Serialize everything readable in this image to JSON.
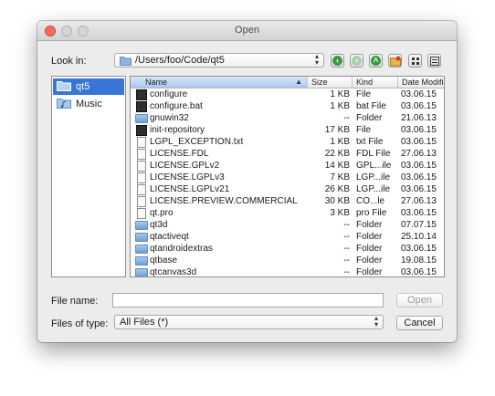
{
  "window": {
    "title": "Open"
  },
  "toolbar": {
    "look_in_label": "Look in:",
    "path": "/Users/foo/Code/qt5",
    "buttons": [
      "back-icon",
      "forward-icon",
      "parent-directory-icon",
      "new-folder-icon",
      "list-view-icon",
      "detail-view-icon"
    ]
  },
  "sidebar": {
    "items": [
      {
        "label": "qt5",
        "icon": "folder-icon",
        "selected": true
      },
      {
        "label": "Music",
        "icon": "music-folder-icon",
        "selected": false
      }
    ]
  },
  "file_list": {
    "columns": [
      "Name",
      "Size",
      "Kind",
      "Date Modified"
    ],
    "sort_column": "Name",
    "rows": [
      {
        "name": "configure",
        "size": "1 KB",
        "kind": "File",
        "date": "03.06.15",
        "icon": "executable-icon"
      },
      {
        "name": "configure.bat",
        "size": "1 KB",
        "kind": "bat File",
        "date": "03.06.15",
        "icon": "executable-icon"
      },
      {
        "name": "gnuwin32",
        "size": "--",
        "kind": "Folder",
        "date": "21.06.13",
        "icon": "folder-icon"
      },
      {
        "name": "init-repository",
        "size": "17 KB",
        "kind": "File",
        "date": "03.06.15",
        "icon": "executable-icon"
      },
      {
        "name": "LGPL_EXCEPTION.txt",
        "size": "1 KB",
        "kind": "txt File",
        "date": "03.06.15",
        "icon": "document-icon"
      },
      {
        "name": "LICENSE.FDL",
        "size": "22 KB",
        "kind": "FDL File",
        "date": "27.06.13",
        "icon": "document-icon"
      },
      {
        "name": "LICENSE.GPLv2",
        "size": "14 KB",
        "kind": "GPL...ile",
        "date": "03.06.15",
        "icon": "document-icon"
      },
      {
        "name": "LICENSE.LGPLv3",
        "size": "7 KB",
        "kind": "LGP...ile",
        "date": "03.06.15",
        "icon": "document-icon"
      },
      {
        "name": "LICENSE.LGPLv21",
        "size": "26 KB",
        "kind": "LGP...ile",
        "date": "03.06.15",
        "icon": "document-icon"
      },
      {
        "name": "LICENSE.PREVIEW.COMMERCIAL",
        "size": "30 KB",
        "kind": "CO...le",
        "date": "27.06.13",
        "icon": "document-icon"
      },
      {
        "name": "qt.pro",
        "size": "3 KB",
        "kind": "pro File",
        "date": "03.06.15",
        "icon": "document-icon"
      },
      {
        "name": "qt3d",
        "size": "--",
        "kind": "Folder",
        "date": "07.07.15",
        "icon": "folder-icon"
      },
      {
        "name": "qtactiveqt",
        "size": "--",
        "kind": "Folder",
        "date": "25.10.14",
        "icon": "folder-icon"
      },
      {
        "name": "qtandroidextras",
        "size": "--",
        "kind": "Folder",
        "date": "03.06.15",
        "icon": "folder-icon"
      },
      {
        "name": "qtbase",
        "size": "--",
        "kind": "Folder",
        "date": "19.08.15",
        "icon": "folder-icon"
      },
      {
        "name": "qtcanvas3d",
        "size": "--",
        "kind": "Folder",
        "date": "03.06.15",
        "icon": "folder-icon"
      }
    ]
  },
  "footer": {
    "file_name_label": "File name:",
    "file_name_value": "",
    "files_of_type_label": "Files of type:",
    "file_type_selected": "All Files (*)",
    "open_label": "Open",
    "cancel_label": "Cancel"
  },
  "colors": {
    "selection": "#3875d7",
    "nav_green": "#3b9a3b",
    "folder_blue": "#6f9fd6"
  }
}
